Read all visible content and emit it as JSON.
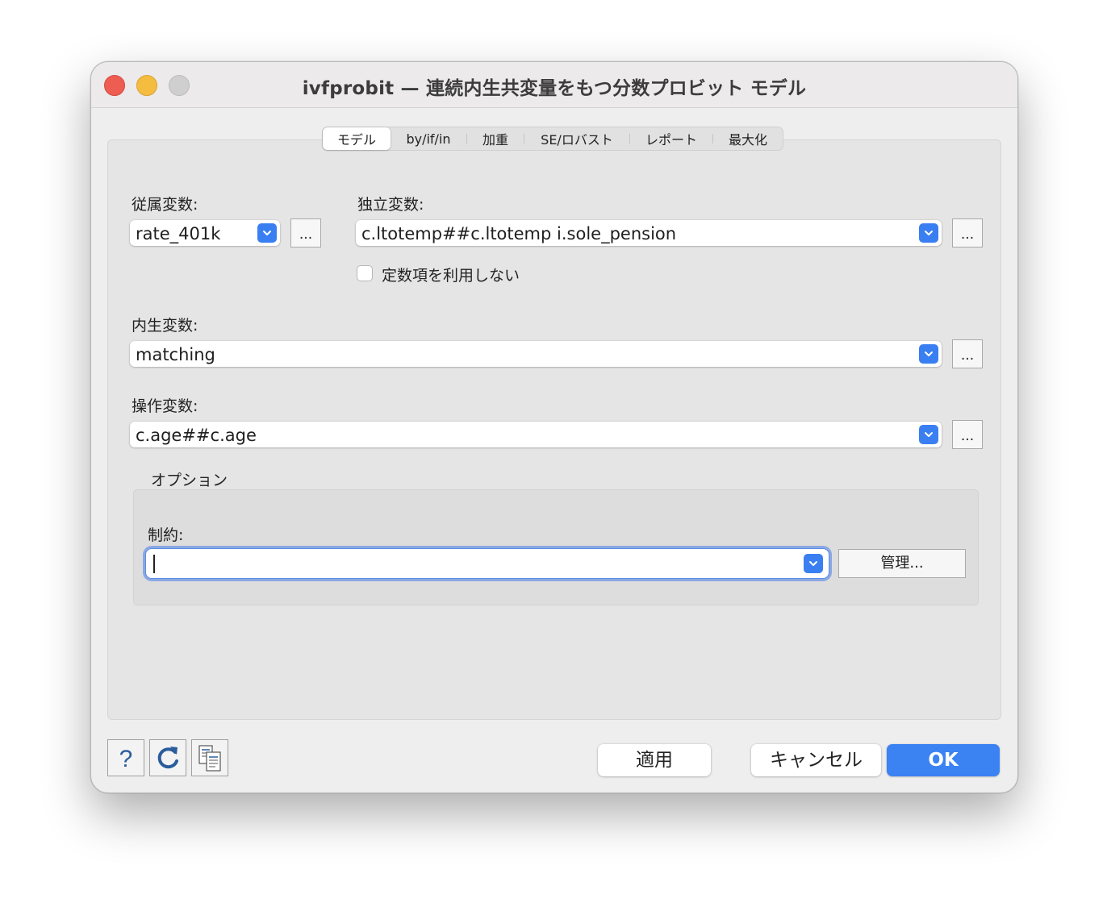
{
  "window": {
    "title": "ivfprobit — 連続内生共変量をもつ分数プロビット モデル"
  },
  "tabs": [
    {
      "label": "モデル",
      "active": true
    },
    {
      "label": "by/if/in",
      "active": false
    },
    {
      "label": "加重",
      "active": false
    },
    {
      "label": "SE/ロバスト",
      "active": false
    },
    {
      "label": "レポート",
      "active": false
    },
    {
      "label": "最大化",
      "active": false
    }
  ],
  "dependent": {
    "label": "従属変数:",
    "value": "rate_401k",
    "more_label": "..."
  },
  "independent": {
    "label": "独立変数:",
    "value": "c.ltotemp##c.ltotemp i.sole_pension",
    "more_label": "..."
  },
  "noconstant": {
    "label": "定数項を利用しない",
    "checked": false
  },
  "endogenous": {
    "label": "内生変数:",
    "value": "matching",
    "more_label": "..."
  },
  "instruments": {
    "label": "操作変数:",
    "value": "c.age##c.age",
    "more_label": "..."
  },
  "options": {
    "group_label": "オプション",
    "constraints_label": "制約:",
    "constraints_value": "",
    "manage_label": "管理..."
  },
  "footer": {
    "help_icon": "question-mark-icon",
    "reset_icon": "refresh-icon",
    "copy_icon": "copy-command-icon",
    "apply_label": "適用",
    "cancel_label": "キャンセル",
    "ok_label": "OK"
  },
  "colors": {
    "accent": "#3b82f3",
    "close": "#ee5d52",
    "minimize": "#f5bd3f"
  }
}
